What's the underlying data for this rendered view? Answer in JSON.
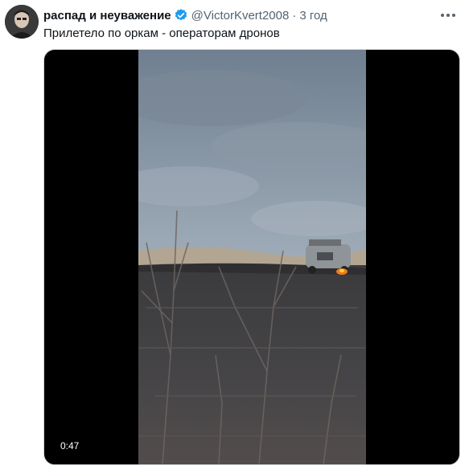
{
  "tweet": {
    "display_name": "распад и неуважение",
    "handle": "@VictorKvert2008",
    "separator": "·",
    "time": "3 год",
    "text": "Прилетело по оркам - операторам дронов"
  },
  "media": {
    "type": "video",
    "duration": "0:47"
  },
  "icons": {
    "verified": "verified-badge-icon",
    "more": "more-options-icon"
  },
  "colors": {
    "verified": "#1d9bf0",
    "secondary_text": "#536471",
    "primary_text": "#0f1419"
  }
}
